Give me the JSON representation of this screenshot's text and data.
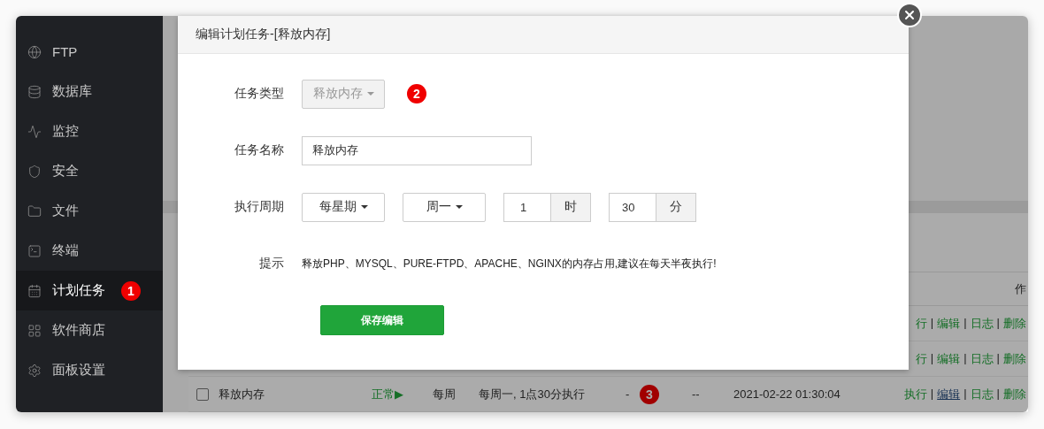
{
  "sidebar": {
    "items": [
      {
        "label": "FTP",
        "selected": false
      },
      {
        "label": "数据库",
        "selected": false
      },
      {
        "label": "监控",
        "selected": false
      },
      {
        "label": "安全",
        "selected": false
      },
      {
        "label": "文件",
        "selected": false
      },
      {
        "label": "终端",
        "selected": false
      },
      {
        "label": "计划任务",
        "selected": true,
        "annotation": "1"
      },
      {
        "label": "软件商店",
        "selected": false
      },
      {
        "label": "面板设置",
        "selected": false
      }
    ]
  },
  "table": {
    "header_fragment": "作",
    "separator": "|",
    "rows": [
      {
        "actions": [
          {
            "label": "行"
          },
          {
            "label": "编辑",
            "hover": false
          },
          {
            "label": "日志",
            "hover": false
          },
          {
            "label": "删除",
            "hover": false
          }
        ]
      },
      {
        "actions": [
          {
            "label": "行"
          },
          {
            "label": "编辑",
            "hover": false
          },
          {
            "label": "日志",
            "hover": false
          },
          {
            "label": "删除",
            "hover": false
          }
        ]
      },
      {
        "checked": false,
        "name": "释放内存",
        "status": "正常▶",
        "period": "每周",
        "schedule": "每周一, 1点30分执行",
        "backup": "-",
        "annotation": "3",
        "backup_to": "--",
        "last_run": "2021-02-22 01:30:04",
        "actions": [
          {
            "label": "执行",
            "hover": false
          },
          {
            "label": "编辑",
            "hover": true
          },
          {
            "label": "日志",
            "hover": false
          },
          {
            "label": "删除",
            "hover": false
          }
        ]
      }
    ]
  },
  "dialog": {
    "title": "编辑计划任务-[释放内存]",
    "type": {
      "label": "任务类型",
      "value": "释放内存",
      "disabled": true,
      "annotation": "2"
    },
    "name": {
      "label": "任务名称",
      "value": "释放内存"
    },
    "period": {
      "label": "执行周期",
      "cycle": "每星期",
      "weekday": "周一",
      "hour": "1",
      "hour_unit": "时",
      "minute": "30",
      "minute_unit": "分"
    },
    "hint": {
      "label": "提示",
      "text": "释放PHP、MYSQL、PURE-FTPD、APACHE、NGINX的内存占用,建议在每天半夜执行!"
    },
    "save_button": "保存编辑"
  }
}
